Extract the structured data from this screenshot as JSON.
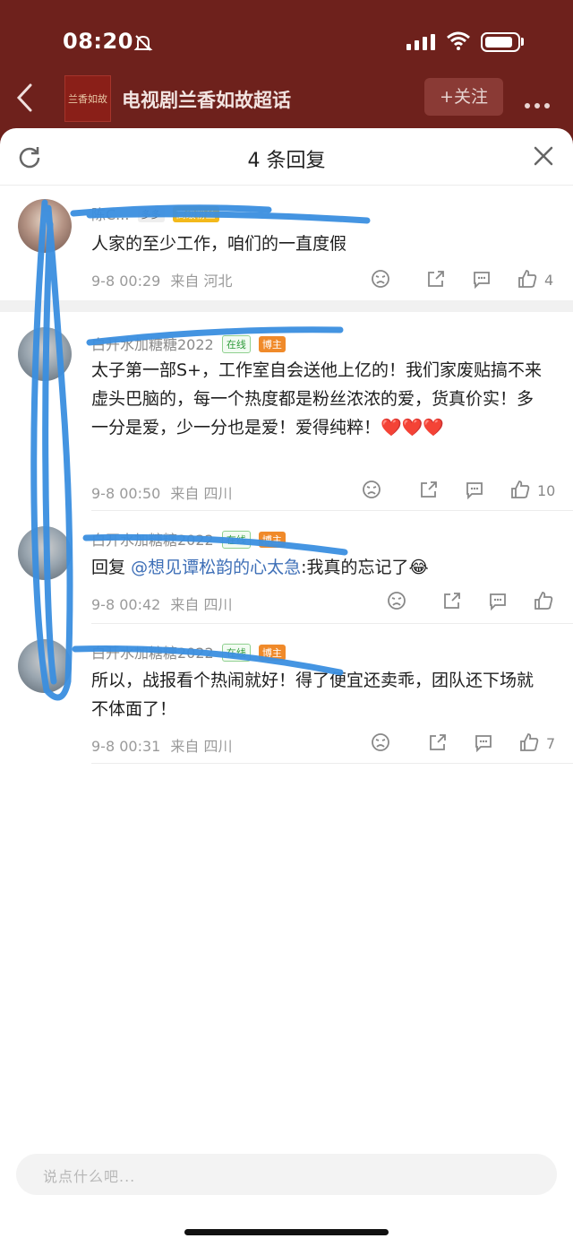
{
  "status_bar": {
    "time": "08:20"
  },
  "header": {
    "logo_text": "兰香如故",
    "title": "电视剧兰香如故超话",
    "follow_label": "+关注"
  },
  "sheet": {
    "title": "4 条回复"
  },
  "comments": [
    {
      "username": "陈C...",
      "badges": [
        "多多",
        "高级粉丝"
      ],
      "text": "人家的至少工作，咱们的一直度假",
      "time": "9-8 00:29",
      "source": "来自 河北",
      "likes": "4"
    },
    {
      "username": "白开水加糖糖2022",
      "badges": [
        "在线",
        "博主"
      ],
      "text": "太子第一部S+，工作室自会送他上亿的！我们家废贴搞不来虚头巴脑的，每一个热度都是粉丝浓浓的爱，货真价实！多一分是爱，少一分也是爱！爱得纯粹！❤️❤️❤️",
      "time": "9-8 00:50",
      "source": "来自 四川",
      "likes": "10"
    },
    {
      "username": "白开水加糖糖2022",
      "badges": [
        "在线",
        "博主"
      ],
      "reply_prefix": "回复",
      "mention": "@想见谭松韵的心太急",
      "text": ":我真的忘记了😂",
      "time": "9-8 00:42",
      "source": "来自 四川",
      "likes": ""
    },
    {
      "username": "白开水加糖糖2022",
      "badges": [
        "在线",
        "博主"
      ],
      "text": "所以，战报看个热闹就好！得了便宜还卖乖，团队还下场就不体面了！",
      "time": "9-8 00:31",
      "source": "来自 四川",
      "likes": "7"
    }
  ],
  "footer": {
    "input_placeholder": "说点什么吧..."
  },
  "colors": {
    "header_bg": "#6e211c",
    "scribble": "#3b8fe0",
    "mention": "#3e6fb7"
  }
}
